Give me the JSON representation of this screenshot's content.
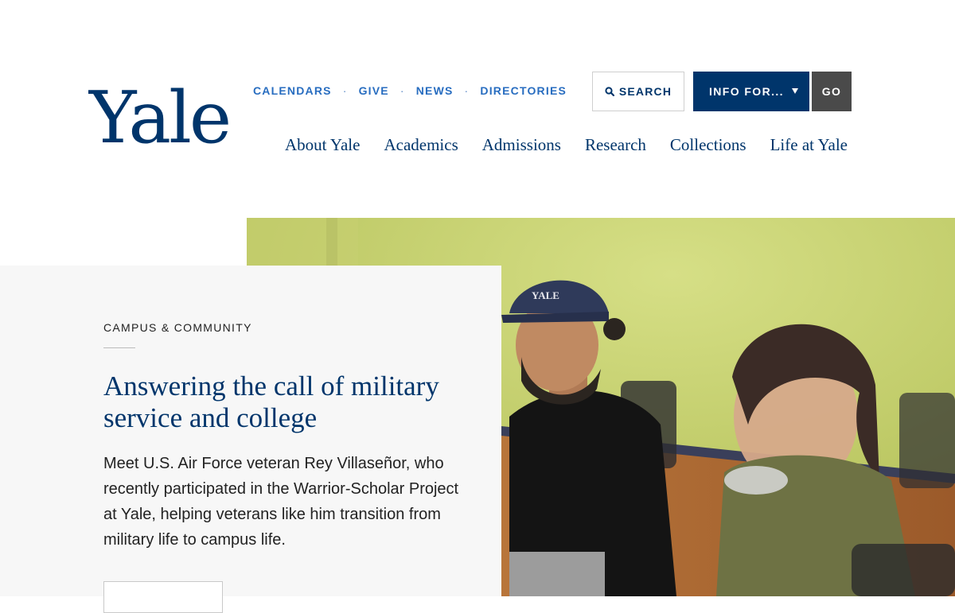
{
  "header": {
    "logo": "Yale",
    "utility_nav": [
      "CALENDARS",
      "GIVE",
      "NEWS",
      "DIRECTORIES"
    ],
    "search_label": "SEARCH",
    "info_select_label": "INFO FOR...",
    "go_label": "GO",
    "main_nav": [
      "About Yale",
      "Academics",
      "Admissions",
      "Research",
      "Collections",
      "Life at Yale"
    ]
  },
  "feature": {
    "eyebrow": "CAMPUS & COMMUNITY",
    "headline": "Answering the call of military service and college",
    "body": "Meet U.S. Air Force veteran Rey Villaseñor, who recently participated in the Warrior-Scholar Project at Yale, helping veterans like him transition from military life to campus life.",
    "photo_cap_text": "YALE"
  },
  "colors": {
    "brand": "#00356b",
    "link": "#286dc0",
    "go_button": "#4a4a4a",
    "card_bg": "#f7f7f7"
  }
}
